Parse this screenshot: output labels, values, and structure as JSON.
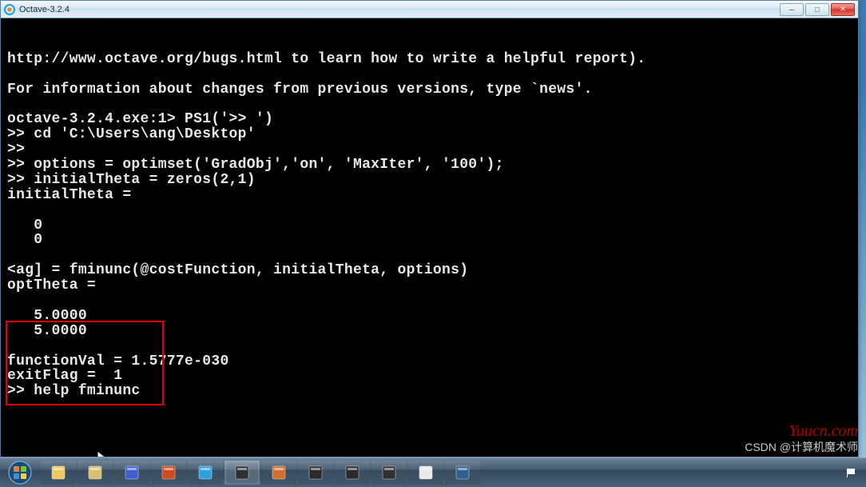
{
  "window": {
    "title": "Octave-3.2.4",
    "min_glyph": "─",
    "max_glyph": "□",
    "close_glyph": "✕"
  },
  "terminal": {
    "lines": [
      "http://www.octave.org/bugs.html to learn how to write a helpful report).",
      "",
      "For information about changes from previous versions, type `news'.",
      "",
      "octave-3.2.4.exe:1> PS1('>> ')",
      ">> cd 'C:\\Users\\ang\\Desktop'",
      ">>",
      ">> options = optimset('GradObj','on', 'MaxIter', '100');",
      ">> initialTheta = zeros(2,1)",
      "initialTheta =",
      "",
      "   0",
      "   0",
      "",
      "<ag] = fminunc(@costFunction, initialTheta, options)",
      "optTheta =",
      "",
      "   5.0000",
      "   5.0000",
      "",
      "functionVal = 1.5777e-030",
      "exitFlag =  1",
      ">> help fminunc"
    ]
  },
  "highlight": {
    "description": "red-rectangle around optTheta output"
  },
  "taskbar": {
    "start_label": "start",
    "items": [
      {
        "name": "explorer-icon",
        "color": "#f0c860"
      },
      {
        "name": "explorer-window-icon",
        "color": "#d8c070"
      },
      {
        "name": "mozilla-icon",
        "color": "#4060d0"
      },
      {
        "name": "powerpoint-icon",
        "color": "#d04a20"
      },
      {
        "name": "octave-icon",
        "color": "#30a0e0"
      },
      {
        "name": "octave-terminal-icon",
        "color": "#2f2f2f"
      },
      {
        "name": "matlab-icon",
        "color": "#d07030"
      },
      {
        "name": "camtasia-icon",
        "color": "#2a2a2a"
      },
      {
        "name": "recorder-icon",
        "color": "#2a2a2a"
      },
      {
        "name": "editor-icon",
        "color": "#303030"
      },
      {
        "name": "file-icon",
        "color": "#e8e8e8"
      },
      {
        "name": "python-icon",
        "color": "#306090"
      }
    ]
  },
  "watermarks": {
    "yuucn": "Yuucn.com",
    "csdn": "CSDN @计算机魔术师"
  }
}
